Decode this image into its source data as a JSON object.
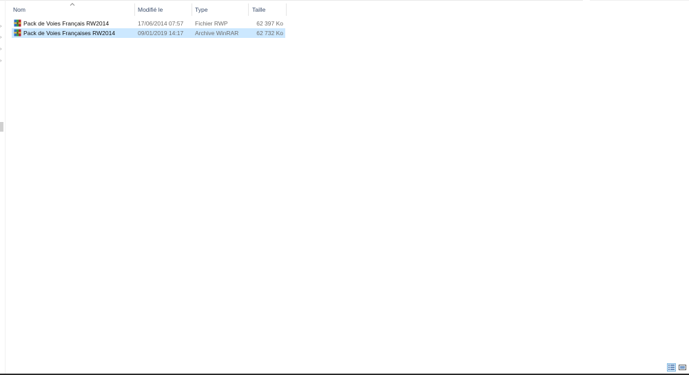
{
  "columns": {
    "name": "Nom",
    "modified": "Modifié le",
    "type": "Type",
    "size": "Taille"
  },
  "sort": {
    "column": "name",
    "direction": "ascending",
    "icon": "sort-up-chevron"
  },
  "files": [
    {
      "name": "Pack de Voies Français RW2014",
      "modified": "17/06/2014 07:57",
      "type": "Fichier RWP",
      "size": "62 397 Ko",
      "icon": "winrar-archive-icon",
      "selected": false
    },
    {
      "name": "Pack de Voies Françaises RW2014",
      "modified": "09/01/2019 14:17",
      "type": "Archive WinRAR",
      "size": "62 732 Ko",
      "icon": "winrar-archive-icon",
      "selected": true
    }
  ],
  "view_mode": "details",
  "colors": {
    "selection": "#cce8ff",
    "header_text": "#3b4d6b",
    "detail_text": "#6d6d6d"
  }
}
